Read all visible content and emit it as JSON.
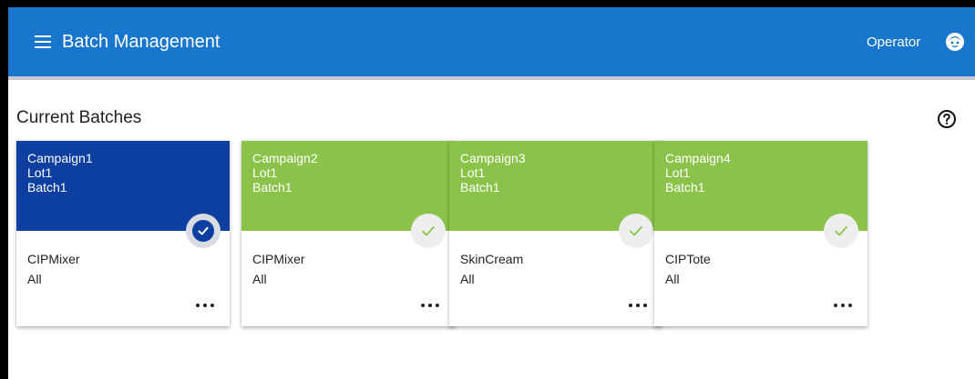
{
  "header": {
    "menu_icon": "hamburger-menu-icon",
    "title": "Batch Management",
    "user_label": "Operator",
    "avatar_icon": "user-face-icon",
    "bar_color": "#1876cd"
  },
  "main": {
    "section_title": "Current Batches",
    "help_icon": "help-circle-icon",
    "cards": [
      {
        "campaign": "Campaign1",
        "lot": "Lot1",
        "batch": "Batch1",
        "name": "CIPMixer",
        "scope": "All",
        "selected": true,
        "header_color": "#0d3fa1",
        "status_icon": "check-circle-filled-icon",
        "more_icon": "more-horizontal-icon"
      },
      {
        "campaign": "Campaign2",
        "lot": "Lot1",
        "batch": "Batch1",
        "name": "CIPMixer",
        "scope": "All",
        "selected": false,
        "header_color": "#8bc34a",
        "status_icon": "check-icon",
        "more_icon": "more-horizontal-icon"
      },
      {
        "campaign": "Campaign3",
        "lot": "Lot1",
        "batch": "Batch1",
        "name": "SkinCream",
        "scope": "All",
        "selected": false,
        "header_color": "#8bc34a",
        "status_icon": "check-icon",
        "more_icon": "more-horizontal-icon"
      },
      {
        "campaign": "Campaign4",
        "lot": "Lot1",
        "batch": "Batch1",
        "name": "CIPTote",
        "scope": "All",
        "selected": false,
        "header_color": "#8bc34a",
        "status_icon": "check-icon",
        "more_icon": "more-horizontal-icon"
      }
    ]
  }
}
